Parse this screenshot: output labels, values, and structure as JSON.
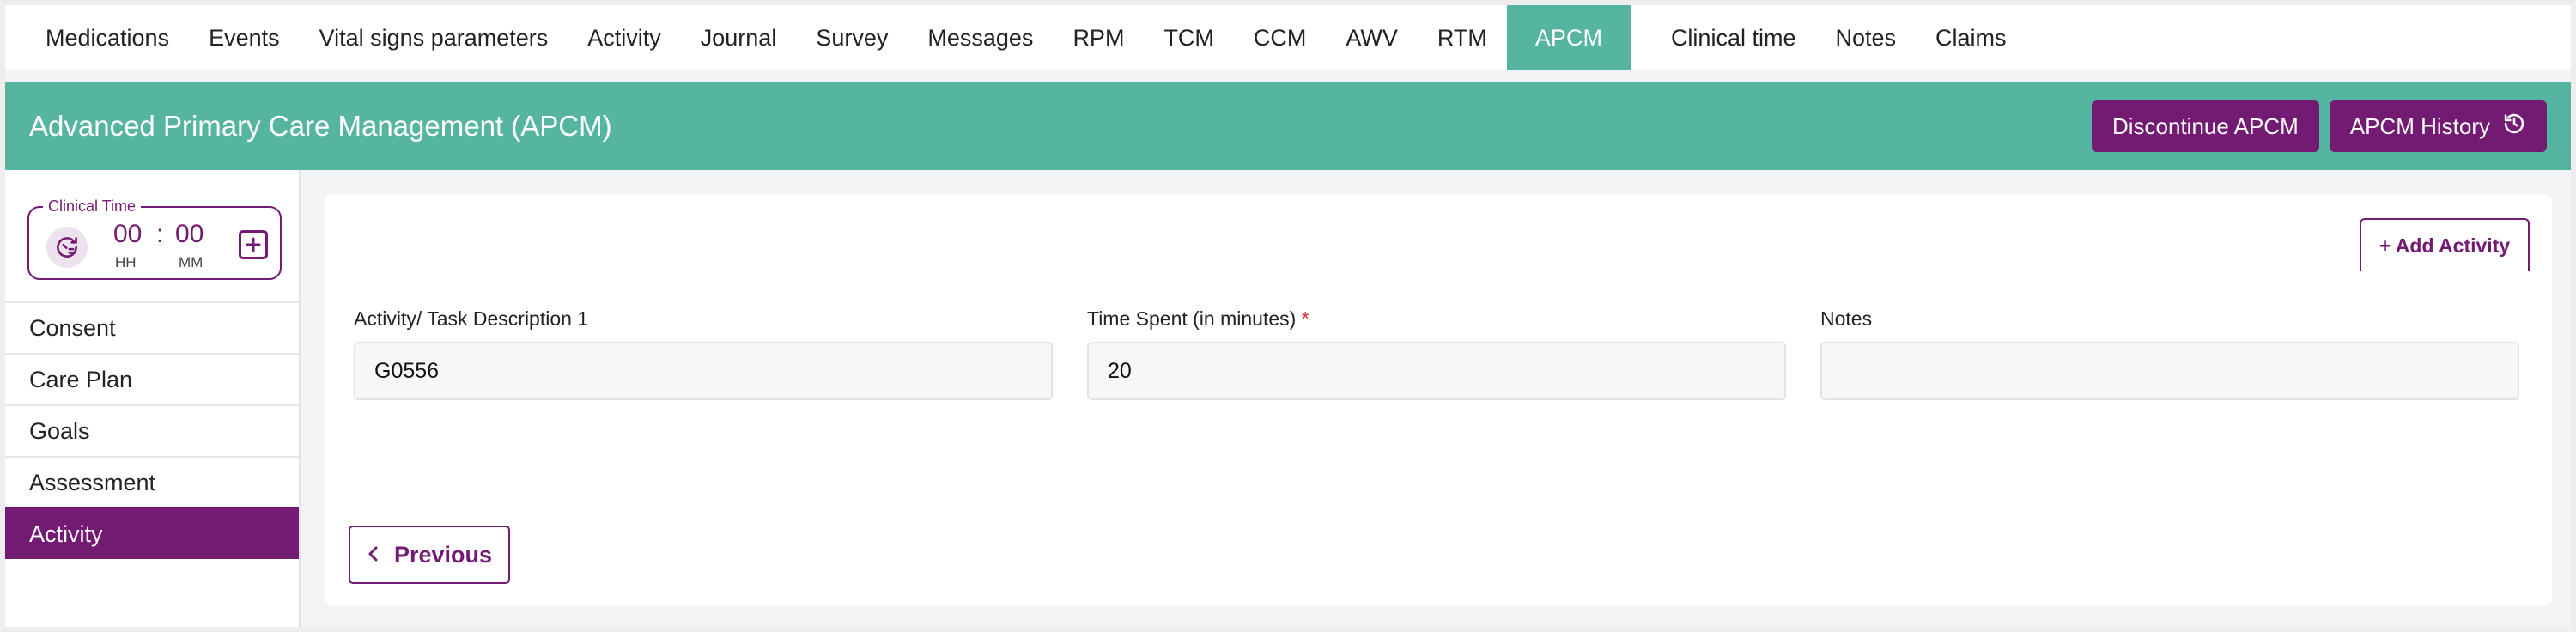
{
  "nav": {
    "tabs": [
      {
        "label": "Medications"
      },
      {
        "label": "Events"
      },
      {
        "label": "Vital signs parameters"
      },
      {
        "label": "Activity"
      },
      {
        "label": "Journal"
      },
      {
        "label": "Survey"
      },
      {
        "label": "Messages"
      },
      {
        "label": "RPM"
      },
      {
        "label": "TCM"
      },
      {
        "label": "CCM"
      },
      {
        "label": "AWV"
      },
      {
        "label": "RTM"
      },
      {
        "label": "APCM",
        "active": true
      },
      {
        "label": "Clinical time"
      },
      {
        "label": "Notes"
      },
      {
        "label": "Claims"
      }
    ]
  },
  "banner": {
    "title": "Advanced Primary Care Management (APCM)",
    "discontinue_label": "Discontinue APCM",
    "history_label": "APCM History",
    "history_icon": "history-icon"
  },
  "clinical_time": {
    "legend": "Clinical Time",
    "hours": "00",
    "separator": ":",
    "minutes": "00",
    "hours_unit": "HH",
    "minutes_unit": "MM",
    "icon": "timer-icon",
    "add_icon": "plus-square-icon"
  },
  "sidebar": {
    "items": [
      {
        "label": "Consent"
      },
      {
        "label": "Care Plan"
      },
      {
        "label": "Goals"
      },
      {
        "label": "Assessment"
      },
      {
        "label": "Activity",
        "active": true
      }
    ]
  },
  "form": {
    "add_activity_label": "+ Add Activity",
    "fields": [
      {
        "label": "Activity/ Task Description",
        "suffix": "1",
        "value": "G0556"
      },
      {
        "label": "Time Spent (in minutes)",
        "required_mark": "*",
        "value": "20"
      },
      {
        "label": "Notes",
        "value": ""
      }
    ],
    "previous_label": "Previous"
  },
  "colors": {
    "brand_teal": "#55b5a0",
    "brand_purple": "#731a73"
  }
}
